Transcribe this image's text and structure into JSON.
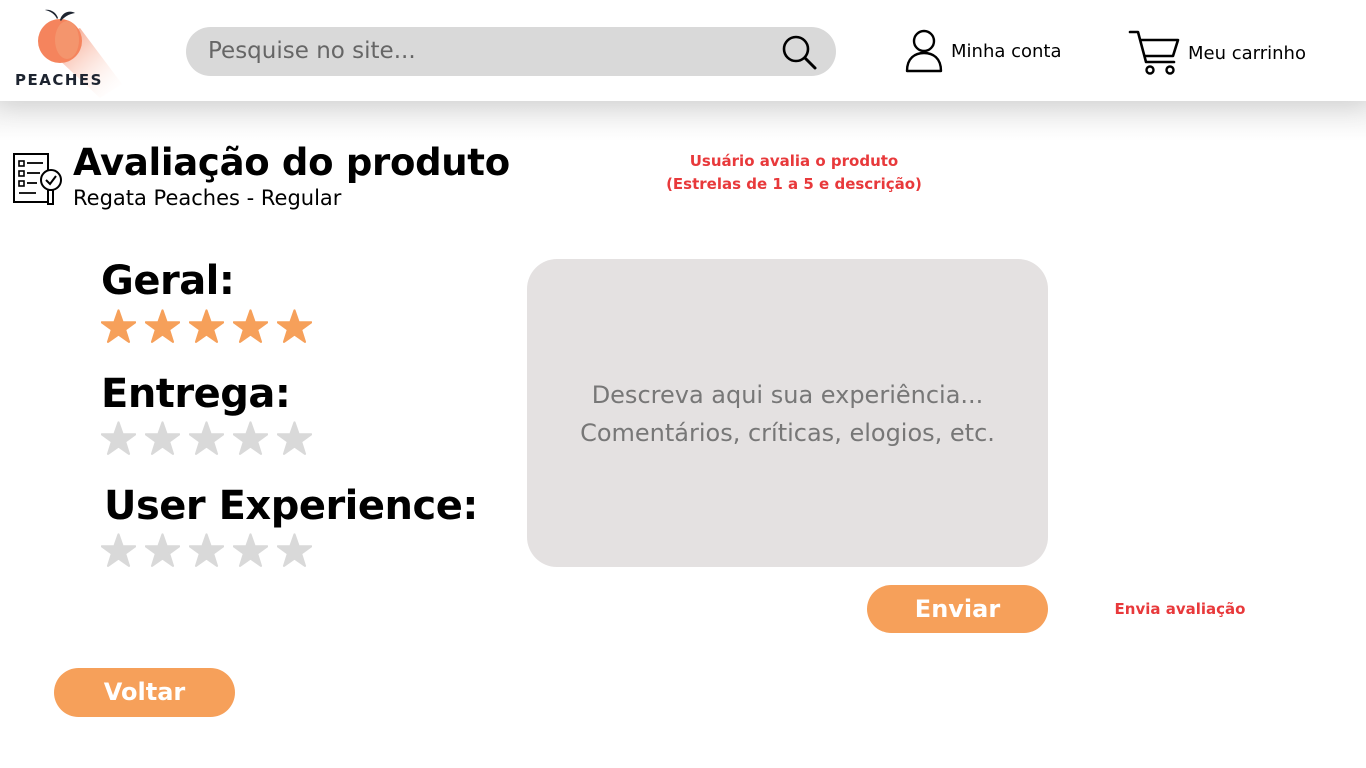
{
  "header": {
    "logo_text": "PEACHES",
    "search_placeholder": "Pesquise no site...",
    "account_label": "Minha conta",
    "cart_label": "Meu carrinho"
  },
  "page": {
    "title": "Avaliação do produto",
    "subtitle": "Regata Peaches - Regular"
  },
  "annotations": {
    "top_note_line1": "Usuário avalia o produto",
    "top_note_line2": "(Estrelas de 1 a 5 e descrição)",
    "send_note": "Envia avaliação"
  },
  "ratings": [
    {
      "label": "Geral:",
      "value": 5,
      "max": 5
    },
    {
      "label": "Entrega:",
      "value": 0,
      "max": 5
    },
    {
      "label": "User Experience:",
      "value": 0,
      "max": 5
    }
  ],
  "review": {
    "placeholder_line1": "Descreva aqui sua experiência...",
    "placeholder_line2": "Comentários, críticas, elogios, etc."
  },
  "buttons": {
    "send": "Enviar",
    "back": "Voltar"
  },
  "colors": {
    "accent": "#f6a05a",
    "star_filled": "#f6a05a",
    "star_empty": "#d9d9d9",
    "annotation": "#e8393b",
    "search_bg": "#d9d9d9",
    "review_bg": "#e4e1e1"
  }
}
